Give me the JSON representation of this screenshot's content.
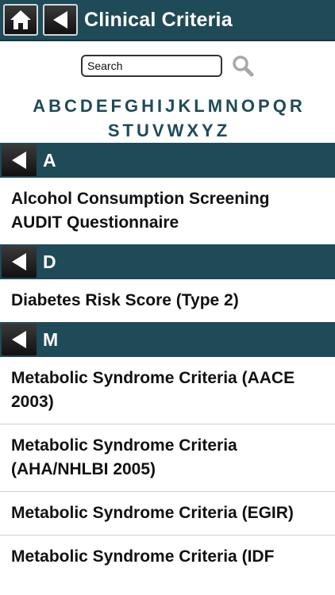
{
  "header": {
    "title": "Clinical Criteria"
  },
  "search": {
    "placeholder": "Search"
  },
  "alphabet": {
    "row1": [
      "A",
      "B",
      "C",
      "D",
      "E",
      "F",
      "G",
      "H",
      "I",
      "J",
      "K",
      "L",
      "M",
      "N",
      "O",
      "P",
      "Q",
      "R"
    ],
    "row2": [
      "S",
      "T",
      "U",
      "V",
      "W",
      "X",
      "Y",
      "Z"
    ]
  },
  "sections": [
    {
      "letter": "A",
      "items": [
        "Alcohol Consumption Screening AUDIT Questionnaire"
      ]
    },
    {
      "letter": "D",
      "items": [
        "Diabetes Risk Score (Type 2)"
      ]
    },
    {
      "letter": "M",
      "items": [
        "Metabolic Syndrome Criteria (AACE 2003)",
        "Metabolic Syndrome Criteria (AHA/NHLBI 2005)",
        "Metabolic Syndrome Criteria (EGIR)",
        "Metabolic Syndrome Criteria (IDF"
      ]
    }
  ],
  "colors": {
    "header_bg": "#1f4a58",
    "accent_text": "#1f4a58"
  },
  "icons": {
    "home": "home-icon",
    "back": "back-arrow-icon",
    "search": "magnifier-icon"
  }
}
